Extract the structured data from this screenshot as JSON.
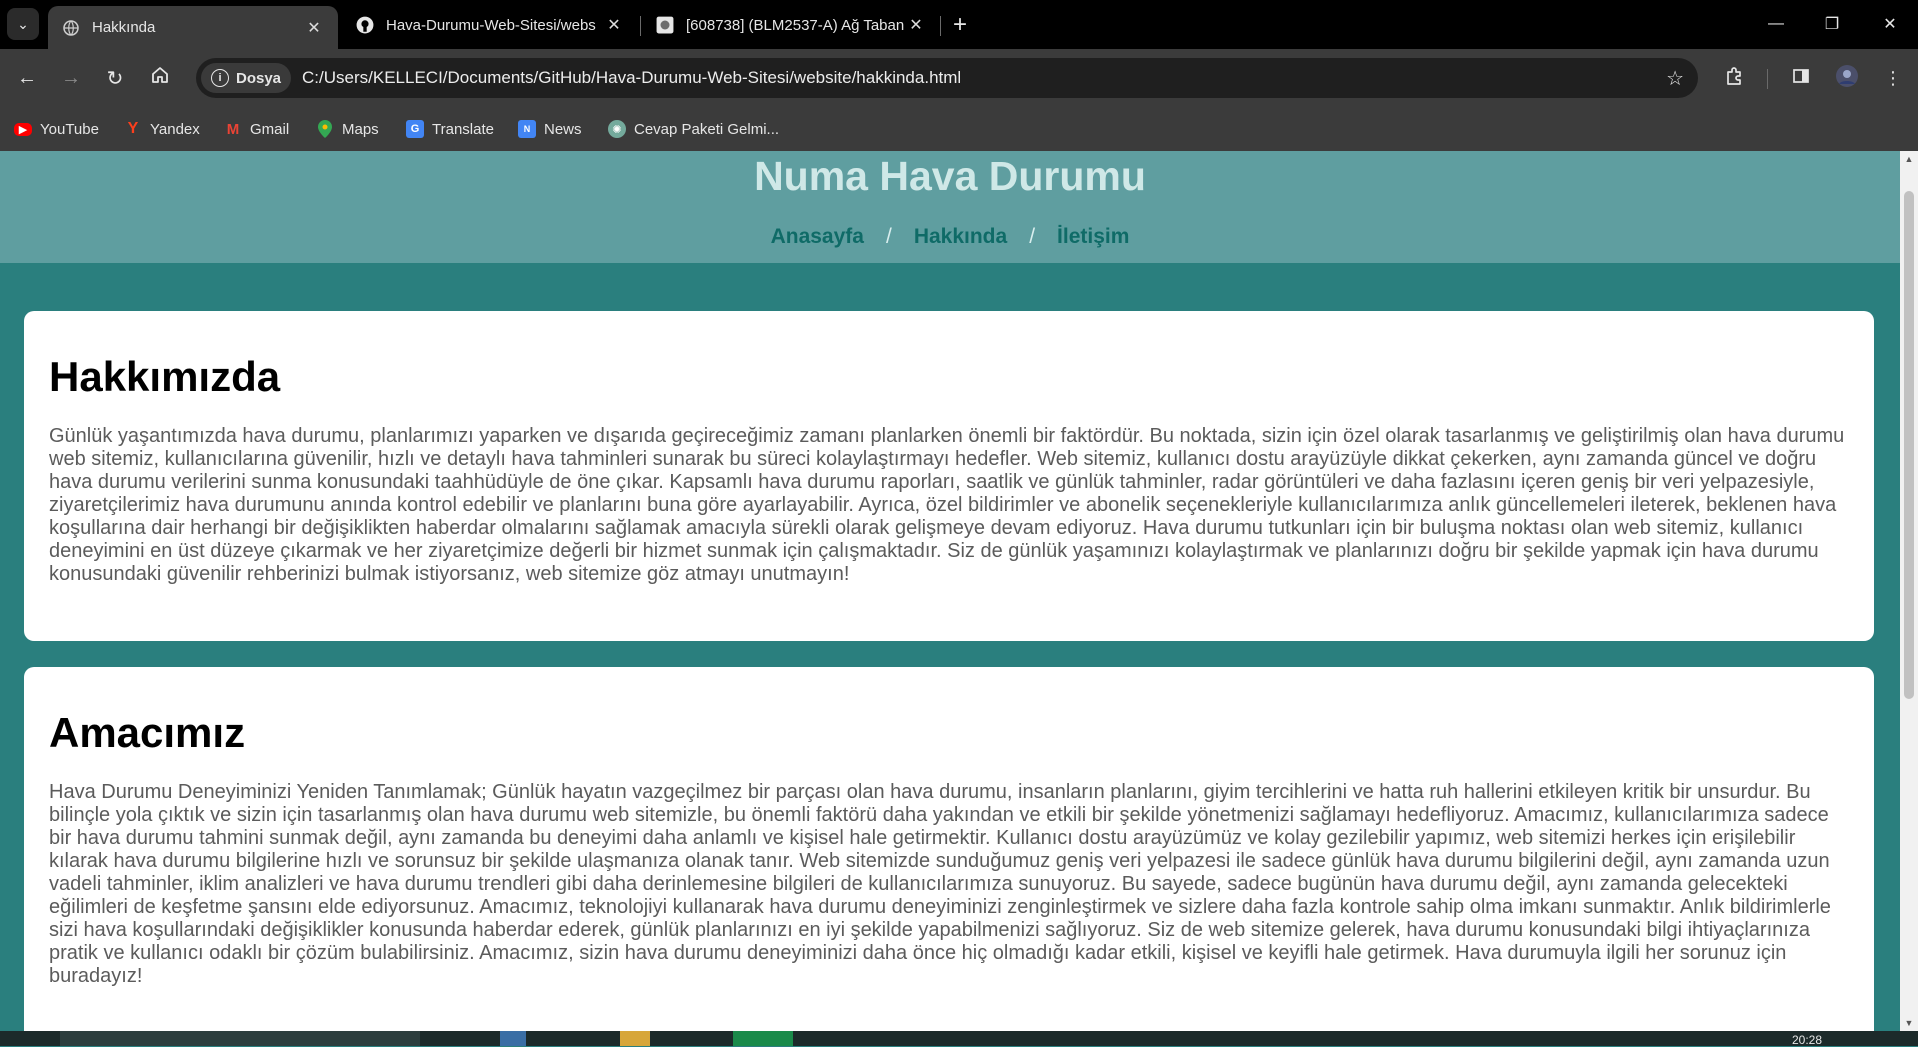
{
  "browser": {
    "tabs": [
      {
        "title": "Hakkında",
        "favicon": "globe-icon",
        "active": true
      },
      {
        "title": "Hava-Durumu-Web-Sitesi/webs",
        "favicon": "github-icon",
        "active": false
      },
      {
        "title": "[608738] (BLM2537-A) Ağ Taban",
        "favicon": "moodle-icon",
        "active": false
      }
    ],
    "site_chip": "Dosya",
    "url": "C:/Users/KELLECI/Documents/GitHub/Hava-Durumu-Web-Sitesi/website/hakkinda.html",
    "bookmarks": [
      {
        "label": "YouTube",
        "icon": "youtube-icon",
        "color": "#ff0000"
      },
      {
        "label": "Yandex",
        "icon": "yandex-icon",
        "color": "#fc3f1d"
      },
      {
        "label": "Gmail",
        "icon": "gmail-icon",
        "color": "#ea4335"
      },
      {
        "label": "Maps",
        "icon": "maps-icon",
        "color": "#34a853"
      },
      {
        "label": "Translate",
        "icon": "translate-icon",
        "color": "#4285f4"
      },
      {
        "label": "News",
        "icon": "news-icon",
        "color": "#4285f4"
      },
      {
        "label": "Cevap Paketi Gelmi...",
        "icon": "chatgpt-icon",
        "color": "#74aa9c"
      }
    ]
  },
  "site": {
    "title": "Numa Hava Durumu",
    "nav": [
      "Anasayfa",
      "Hakkında",
      "İletişim"
    ],
    "separator": "/"
  },
  "sections": [
    {
      "heading": "Hakkımızda",
      "text": "Günlük yaşantımızda hava durumu, planlarımızı yaparken ve dışarıda geçireceğimiz zamanı planlarken önemli bir faktördür. Bu noktada, sizin için özel olarak tasarlanmış ve geliştirilmiş olan hava durumu web sitemiz, kullanıcılarına güvenilir, hızlı ve detaylı hava tahminleri sunarak bu süreci kolaylaştırmayı hedefler. Web sitemiz, kullanıcı dostu arayüzüyle dikkat çekerken, aynı zamanda güncel ve doğru hava durumu verilerini sunma konusundaki taahhüdüyle de öne çıkar. Kapsamlı hava durumu raporları, saatlik ve günlük tahminler, radar görüntüleri ve daha fazlasını içeren geniş bir veri yelpazesiyle, ziyaretçilerimiz hava durumunu anında kontrol edebilir ve planlarını buna göre ayarlayabilir. Ayrıca, özel bildirimler ve abonelik seçenekleriyle kullanıcılarımıza anlık güncellemeleri ileterek, beklenen hava koşullarına dair herhangi bir değişiklikten haberdar olmalarını sağlamak amacıyla sürekli olarak gelişmeye devam ediyoruz. Hava durumu tutkunları için bir buluşma noktası olan web sitemiz, kullanıcı deneyimini en üst düzeye çıkarmak ve her ziyaretçimize değerli bir hizmet sunmak için çalışmaktadır. Siz de günlük yaşamınızı kolaylaştırmak ve planlarınızı doğru bir şekilde yapmak için hava durumu konusundaki güvenilir rehberinizi bulmak istiyorsanız, web sitemize göz atmayı unutmayın!"
    },
    {
      "heading": "Amacımız",
      "text": "Hava Durumu Deneyiminizi Yeniden Tanımlamak; Günlük hayatın vazgeçilmez bir parçası olan hava durumu, insanların planlarını, giyim tercihlerini ve hatta ruh hallerini etkileyen kritik bir unsurdur. Bu bilinçle yola çıktık ve sizin için tasarlanmış olan hava durumu web sitemizle, bu önemli faktörü daha yakından ve etkili bir şekilde yönetmenizi sağlamayı hedefliyoruz. Amacımız, kullanıcılarımıza sadece bir hava durumu tahmini sunmak değil, aynı zamanda bu deneyimi daha anlamlı ve kişisel hale getirmektir. Kullanıcı dostu arayüzümüz ve kolay gezilebilir yapımız, web sitemizi herkes için erişilebilir kılarak hava durumu bilgilerine hızlı ve sorunsuz bir şekilde ulaşmanıza olanak tanır. Web sitemizde sunduğumuz geniş veri yelpazesi ile sadece günlük hava durumu bilgilerini değil, aynı zamanda uzun vadeli tahminler, iklim analizleri ve hava durumu trendleri gibi daha derinlemesine bilgileri de kullanıcılarımıza sunuyoruz. Bu sayede, sadece bugünün hava durumu değil, aynı zamanda gelecekteki eğilimleri de keşfetme şansını elde ediyorsunuz. Amacımız, teknolojiyi kullanarak hava durumu deneyiminizi zenginleştirmek ve sizlere daha fazla kontrole sahip olma imkanı sunmaktır. Anlık bildirimlerle sizi hava koşullarındaki değişiklikler konusunda haberdar ederek, günlük planlarınızı en iyi şekilde yapabilmenizi sağlıyoruz. Siz de web sitemize gelerek, hava durumu konusundaki bilgi ihtiyaçlarınıza pratik ve kullanıcı odaklı bir çözüm bulabilirsiniz. Amacımız, sizin hava durumu deneyiminizi daha önce hiç olmadığı kadar etkili, kişisel ve keyifli hale getirmek. Hava durumuyla ilgili her sorunuz için buradayız!"
    }
  ],
  "taskbar": {
    "clock": "20:28"
  }
}
